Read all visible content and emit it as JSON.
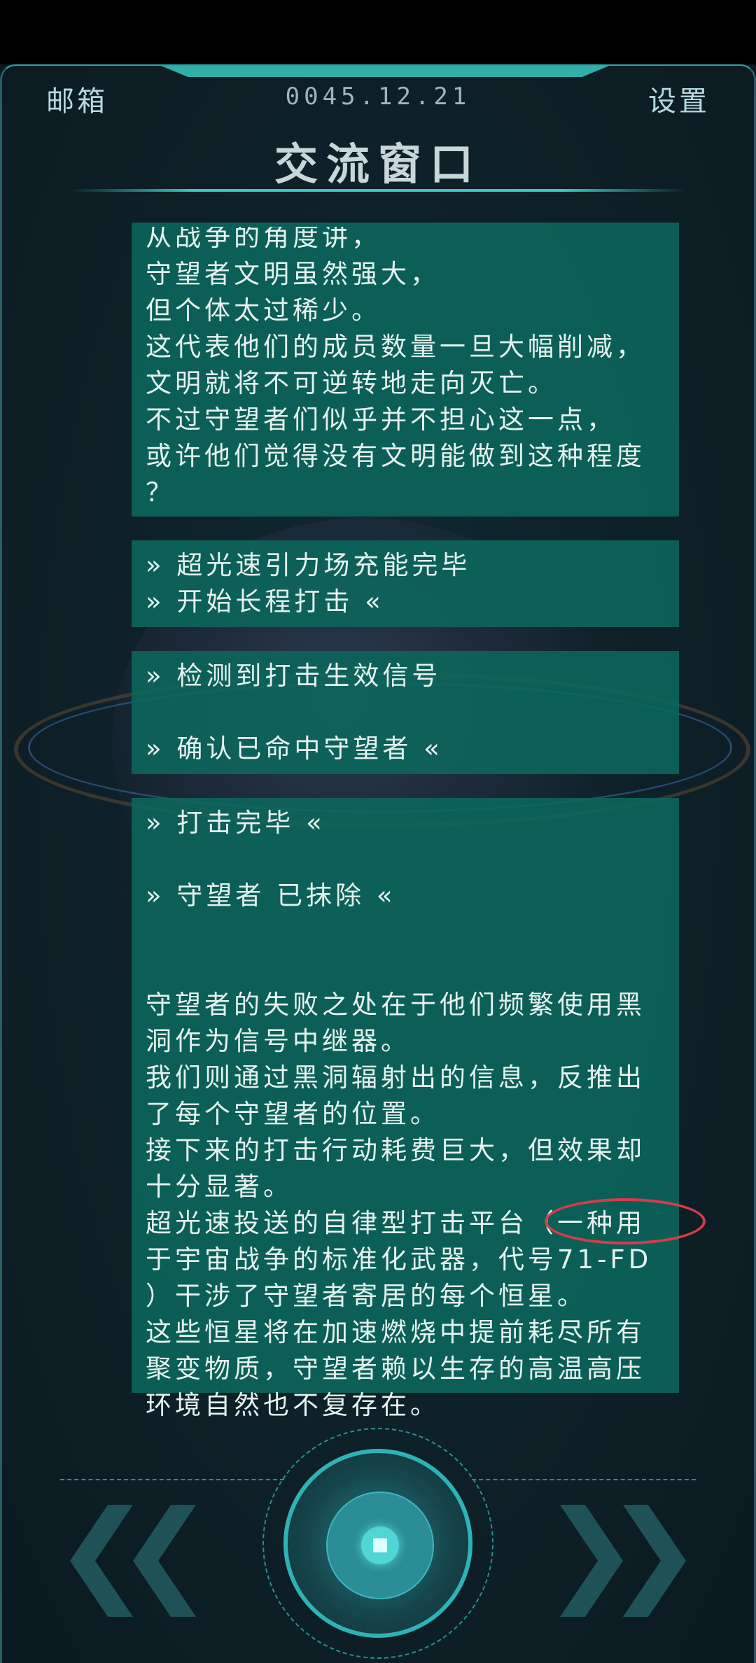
{
  "header": {
    "mail_label": "邮箱",
    "date": "0045.12.21",
    "settings_label": "设置"
  },
  "page": {
    "title": "交流窗口"
  },
  "messages": [
    {
      "lines": [
        "从战争的角度讲，",
        "守望者文明虽然强大，",
        "但个体太过稀少。",
        "这代表他们的成员数量一旦大幅削减，",
        "文明就将不可逆转地走向灭亡。",
        "不过守望者们似乎并不担心这一点，",
        "或许他们觉得没有文明能做到这种程度",
        "？"
      ]
    },
    {
      "lines": [
        "» 超光速引力场充能完毕",
        "» 开始长程打击 «"
      ]
    },
    {
      "lines": [
        "» 检测到打击生效信号",
        "",
        "» 确认已命中守望者 «"
      ]
    },
    {
      "lines": [
        "» 打击完毕 «",
        "",
        "» 守望者 已抹除 «",
        "",
        "",
        "守望者的失败之处在于他们频繁使用黑",
        "洞作为信号中继器。",
        "我们则通过黑洞辐射出的信息，反推出",
        "了每个守望者的位置。",
        "接下来的打击行动耗费巨大，但效果却",
        "十分显著。",
        "超光速投送的自律型打击平台（一种用",
        "于宇宙战争的标准化武器，代号71-FD",
        "）干涉了守望者寄居的每个恒星。",
        "这些恒星将在加速燃烧中提前耗尽所有",
        "聚变物质，守望者赖以生存的高温高压",
        "环境自然也不复存在。"
      ]
    }
  ],
  "controls": {
    "prev_icon": "double-chevron-left-icon",
    "center_icon": "stop-icon",
    "next_icon": "double-chevron-right-icon"
  },
  "colors": {
    "accent": "#38c9c0",
    "bubble": "#0b685c",
    "annotation": "#d63c4a"
  }
}
